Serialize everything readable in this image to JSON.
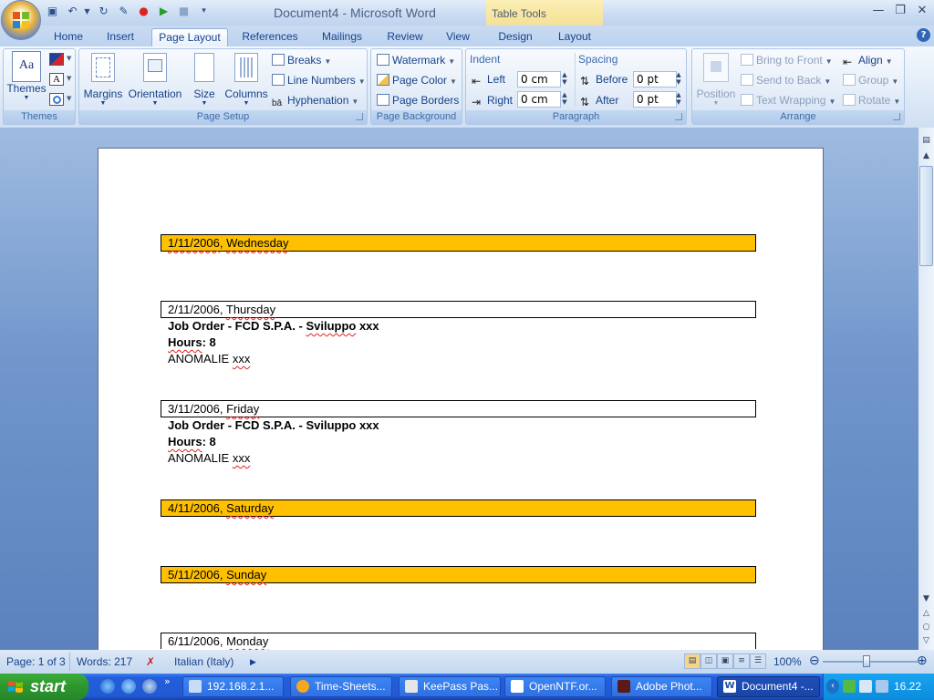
{
  "window": {
    "title": "Document4 - Microsoft Word",
    "contextual_tab_group": "Table Tools"
  },
  "tabs": [
    "Home",
    "Insert",
    "Page Layout",
    "References",
    "Mailings",
    "Review",
    "View",
    "Design",
    "Layout"
  ],
  "active_tab": "Page Layout",
  "ribbon": {
    "themes": {
      "button_label": "Themes",
      "group_label": "Themes"
    },
    "page_setup": {
      "margins": "Margins",
      "orientation": "Orientation",
      "size": "Size",
      "columns": "Columns",
      "breaks": "Breaks",
      "line_numbers": "Line Numbers",
      "hyphenation": "Hyphenation",
      "group_label": "Page Setup"
    },
    "page_background": {
      "watermark": "Watermark",
      "page_color": "Page Color",
      "page_borders": "Page Borders",
      "group_label": "Page Background"
    },
    "paragraph": {
      "indent_heading": "Indent",
      "left_label": "Left",
      "left_value": "0 cm",
      "right_label": "Right",
      "right_value": "0 cm",
      "spacing_heading": "Spacing",
      "before_label": "Before",
      "before_value": "0 pt",
      "after_label": "After",
      "after_value": "0 pt",
      "group_label": "Paragraph"
    },
    "arrange": {
      "position": "Position",
      "bring_to_front": "Bring to Front",
      "send_to_back": "Send to Back",
      "text_wrapping": "Text Wrapping",
      "align": "Align",
      "group": "Group",
      "rotate": "Rotate",
      "group_label": "Arrange"
    }
  },
  "document": {
    "entries": [
      {
        "date": "1/11/2006",
        "day": "Wednesday",
        "weekend": true
      },
      {
        "date": "2/11/2006",
        "day": "Thursday",
        "weekend": false,
        "job_order_prefix": "Job Order - FCD S.P.A. - ",
        "job_order_word": "Sviluppo",
        "job_order_suffix": " xxx",
        "hours_label": "Hours",
        "hours_value": ": 8",
        "anomalie": "ANOMALIE",
        "anomalie_suffix": "xxx"
      },
      {
        "date": "3/11/2006",
        "day": "Friday",
        "weekend": false,
        "job_order_prefix": "Job Order - FCD S.P.A. - ",
        "job_order_word": "Sviluppo",
        "job_order_suffix": " xxx",
        "hours_label": "Hours",
        "hours_value": ": 8",
        "anomalie": "ANOMALIE",
        "anomalie_suffix": "xxx"
      },
      {
        "date": "4/11/2006",
        "day": "Saturday",
        "weekend": true
      },
      {
        "date": "5/11/2006",
        "day": "Sunday",
        "weekend": true
      },
      {
        "date": "6/11/2006",
        "day": "Monday",
        "weekend": false
      }
    ],
    "weekend_highlight_color": "#ffc000"
  },
  "statusbar": {
    "page": "Page: 1 of 3",
    "words": "Words: 217",
    "language": "Italian (Italy)",
    "zoom": "100%",
    "zoom_level": 1.0
  },
  "taskbar": {
    "start": "start",
    "items": [
      "192.168.2.1...",
      "Time-Sheets...",
      "KeePass Pas...",
      "OpenNTF.or...",
      "Adobe Phot...",
      "Document4 -..."
    ],
    "active_item": "Document4 -...",
    "clock": "16.22"
  },
  "colors": {
    "ribbon_text": "#15428b",
    "weekend_fill": "#ffc000",
    "taskbar_blue": "#245edc",
    "start_green": "#2f9a2f"
  }
}
